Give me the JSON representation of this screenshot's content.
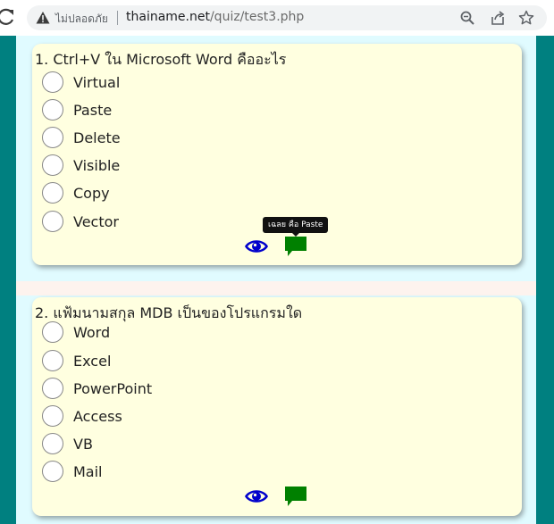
{
  "browser": {
    "security_label": "ไม่ปลอดภัย",
    "url_host": "thainame.net",
    "url_path": "/quiz/test3.php",
    "icons": [
      "reload-icon",
      "warning-icon",
      "zoom-icon",
      "share-icon",
      "star-icon"
    ]
  },
  "questions": [
    {
      "text": "1. Ctrl+V ใน Microsoft Word คืออะไร",
      "options": [
        "Virtual",
        "Paste",
        "Delete",
        "Visible",
        "Copy",
        "Vector"
      ],
      "tooltip": "เฉลย คือ Paste"
    },
    {
      "text": "2. แฟ้มนามสกุล MDB เป็นของโปรแกรมใด",
      "options": [
        "Word",
        "Excel",
        "PowerPoint",
        "Access",
        "VB",
        "Mail"
      ]
    }
  ],
  "colors": {
    "background": "#008080",
    "page": "#e0fbff",
    "card": "#ffffe0",
    "eye_icon": "#0000cc",
    "chat_icon": "#008000"
  }
}
